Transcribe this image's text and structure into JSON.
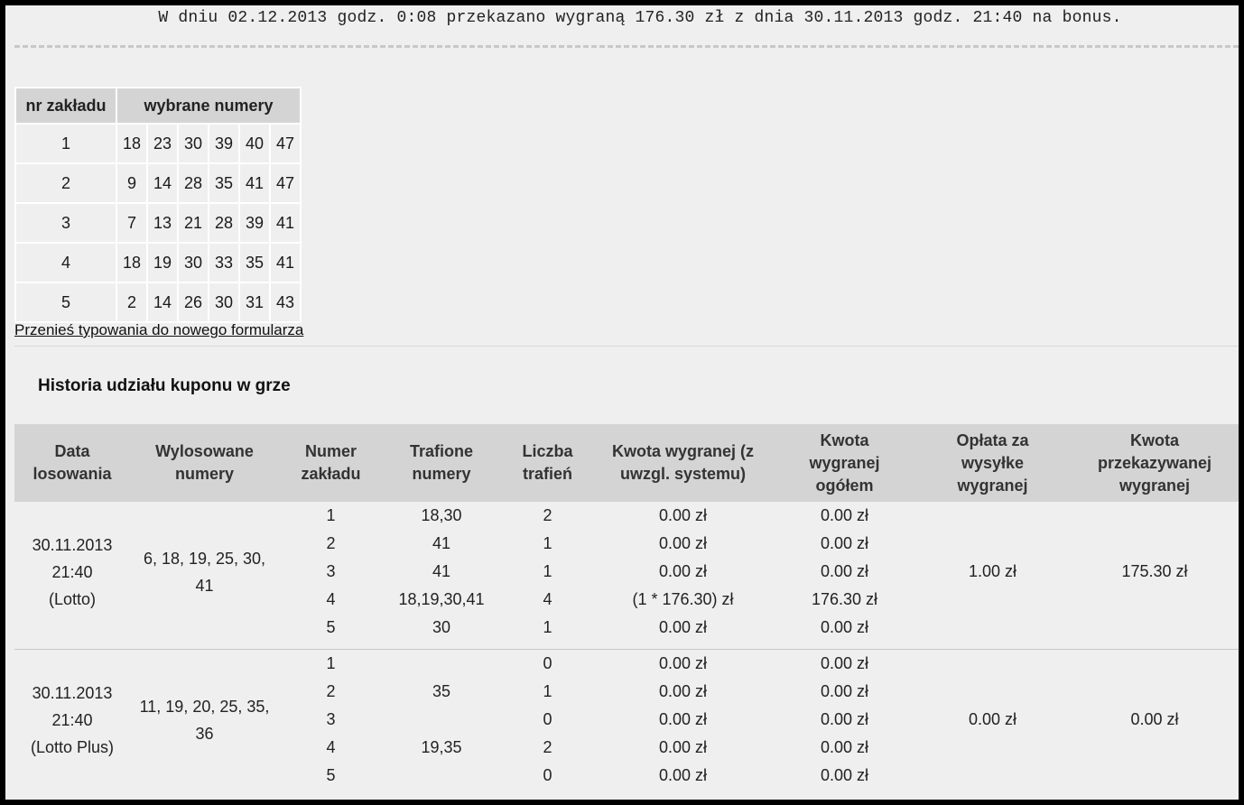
{
  "notice": "W dniu 02.12.2013 godz. 0:08 przekazano wygraną 176.30 zł z dnia 30.11.2013 godz. 21:40 na bonus.",
  "bets_table": {
    "header_nr": "nr zakładu",
    "header_numbers": "wybrane numery",
    "rows": [
      {
        "nr": "1",
        "numbers": [
          "18",
          "23",
          "30",
          "39",
          "40",
          "47"
        ]
      },
      {
        "nr": "2",
        "numbers": [
          "9",
          "14",
          "28",
          "35",
          "41",
          "47"
        ]
      },
      {
        "nr": "3",
        "numbers": [
          "7",
          "13",
          "21",
          "28",
          "39",
          "41"
        ]
      },
      {
        "nr": "4",
        "numbers": [
          "18",
          "19",
          "30",
          "33",
          "35",
          "41"
        ]
      },
      {
        "nr": "5",
        "numbers": [
          "2",
          "14",
          "26",
          "30",
          "31",
          "43"
        ]
      }
    ]
  },
  "transfer_link": "Przenieś typowania do nowego formularza",
  "history": {
    "title": "Historia udziału kuponu w grze",
    "headers": [
      [
        "Data",
        "losowania"
      ],
      [
        "Wylosowane",
        "numery"
      ],
      [
        "Numer",
        "zakładu"
      ],
      [
        "Trafione",
        "numery"
      ],
      [
        "Liczba",
        "trafień"
      ],
      [
        "Kwota wygranej (z",
        "uwzgl. systemu)"
      ],
      [
        "Kwota",
        "wygranej",
        "ogółem"
      ],
      [
        "Opłata za",
        "wysyłke",
        "wygranej"
      ],
      [
        "Kwota",
        "przekazywanej",
        "wygranej"
      ]
    ],
    "groups": [
      {
        "date": [
          "30.11.2013",
          "21:40",
          "(Lotto)"
        ],
        "drawn": [
          "6, 18, 19, 25, 30,",
          "41"
        ],
        "fee": "1.00 zł",
        "transferred": "175.30 zł",
        "rows": [
          {
            "bet": "1",
            "hit": "18,30",
            "count": "2",
            "win": "0.00 zł",
            "total": "0.00 zł"
          },
          {
            "bet": "2",
            "hit": "41",
            "count": "1",
            "win": "0.00 zł",
            "total": "0.00 zł"
          },
          {
            "bet": "3",
            "hit": "41",
            "count": "1",
            "win": "0.00 zł",
            "total": "0.00 zł"
          },
          {
            "bet": "4",
            "hit": "18,19,30,41",
            "count": "4",
            "win": "(1 * 176.30) zł",
            "total": "176.30 zł"
          },
          {
            "bet": "5",
            "hit": "30",
            "count": "1",
            "win": "0.00 zł",
            "total": "0.00 zł"
          }
        ]
      },
      {
        "date": [
          "30.11.2013",
          "21:40",
          "(Lotto Plus)"
        ],
        "drawn": [
          "11, 19, 20, 25, 35,",
          "36"
        ],
        "fee": "0.00 zł",
        "transferred": "0.00 zł",
        "rows": [
          {
            "bet": "1",
            "hit": "",
            "count": "0",
            "win": "0.00 zł",
            "total": "0.00 zł"
          },
          {
            "bet": "2",
            "hit": "35",
            "count": "1",
            "win": "0.00 zł",
            "total": "0.00 zł"
          },
          {
            "bet": "3",
            "hit": "",
            "count": "0",
            "win": "0.00 zł",
            "total": "0.00 zł"
          },
          {
            "bet": "4",
            "hit": "19,35",
            "count": "2",
            "win": "0.00 zł",
            "total": "0.00 zł"
          },
          {
            "bet": "5",
            "hit": "",
            "count": "0",
            "win": "0.00 zł",
            "total": "0.00 zł"
          }
        ]
      }
    ]
  }
}
